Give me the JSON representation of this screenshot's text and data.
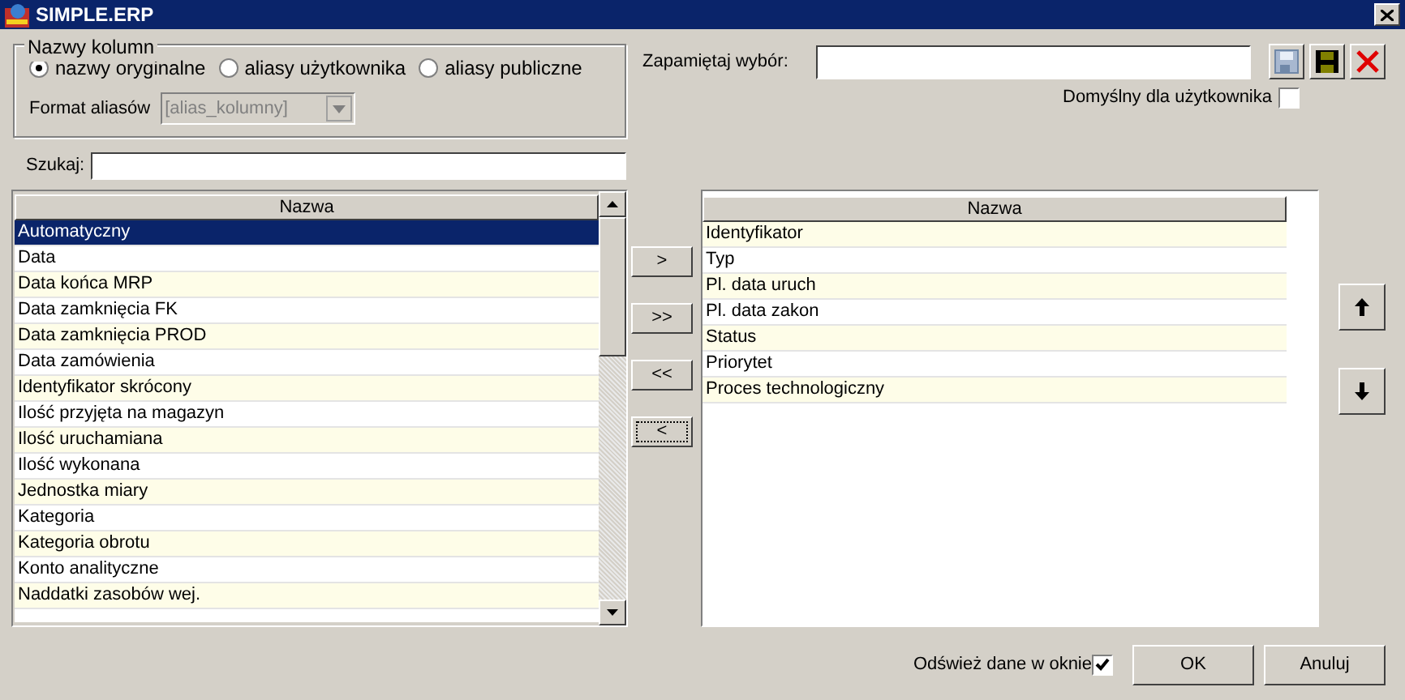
{
  "window": {
    "title": "SIMPLE.ERP"
  },
  "column_names": {
    "legend": "Nazwy kolumn",
    "options": [
      {
        "label": "nazwy oryginalne",
        "selected": true
      },
      {
        "label": "aliasy użytkownika",
        "selected": false
      },
      {
        "label": "aliasy publiczne",
        "selected": false
      }
    ],
    "alias_format": {
      "label": "Format aliasów",
      "value": "[alias_kolumny]",
      "disabled": true
    }
  },
  "search": {
    "label": "Szukaj:"
  },
  "remember": {
    "label": "Zapamiętaj wybór:",
    "default_for_user": {
      "label": "Domyślny dla użytkownika",
      "checked": false
    }
  },
  "available": {
    "header": "Nazwa",
    "items": [
      {
        "label": "Automatyczny",
        "selected": true
      },
      {
        "label": "Data",
        "selected": false
      },
      {
        "label": "Data końca MRP",
        "selected": false
      },
      {
        "label": "Data zamknięcia FK",
        "selected": false
      },
      {
        "label": "Data zamknięcia PROD",
        "selected": false
      },
      {
        "label": "Data zamówienia",
        "selected": false
      },
      {
        "label": "Identyfikator skrócony",
        "selected": false
      },
      {
        "label": "Ilość przyjęta na magazyn",
        "selected": false
      },
      {
        "label": "Ilość uruchamiana",
        "selected": false
      },
      {
        "label": "Ilość wykonana",
        "selected": false
      },
      {
        "label": "Jednostka miary",
        "selected": false
      },
      {
        "label": "Kategoria",
        "selected": false
      },
      {
        "label": "Kategoria obrotu",
        "selected": false
      },
      {
        "label": "Konto analityczne",
        "selected": false
      },
      {
        "label": "Naddatki zasobów wej.",
        "selected": false
      }
    ]
  },
  "transfer_buttons": [
    {
      "label": ">",
      "focused": false
    },
    {
      "label": ">>",
      "focused": false
    },
    {
      "label": "<<",
      "focused": false
    },
    {
      "label": "<",
      "focused": true
    }
  ],
  "chosen": {
    "header": "Nazwa",
    "items": [
      {
        "label": "Identyfikator",
        "selected": false
      },
      {
        "label": "Typ",
        "selected": false
      },
      {
        "label": "Pl. data uruch",
        "selected": false
      },
      {
        "label": "Pl. data zakon",
        "selected": false
      },
      {
        "label": "Status",
        "selected": false
      },
      {
        "label": "Priorytet",
        "selected": false
      },
      {
        "label": "Proces technologiczny",
        "selected": false
      }
    ]
  },
  "refresh": {
    "label": "Odśwież dane w oknie",
    "checked": true
  },
  "buttons": [
    {
      "label": "OK"
    },
    {
      "label": "Anuluj"
    }
  ]
}
